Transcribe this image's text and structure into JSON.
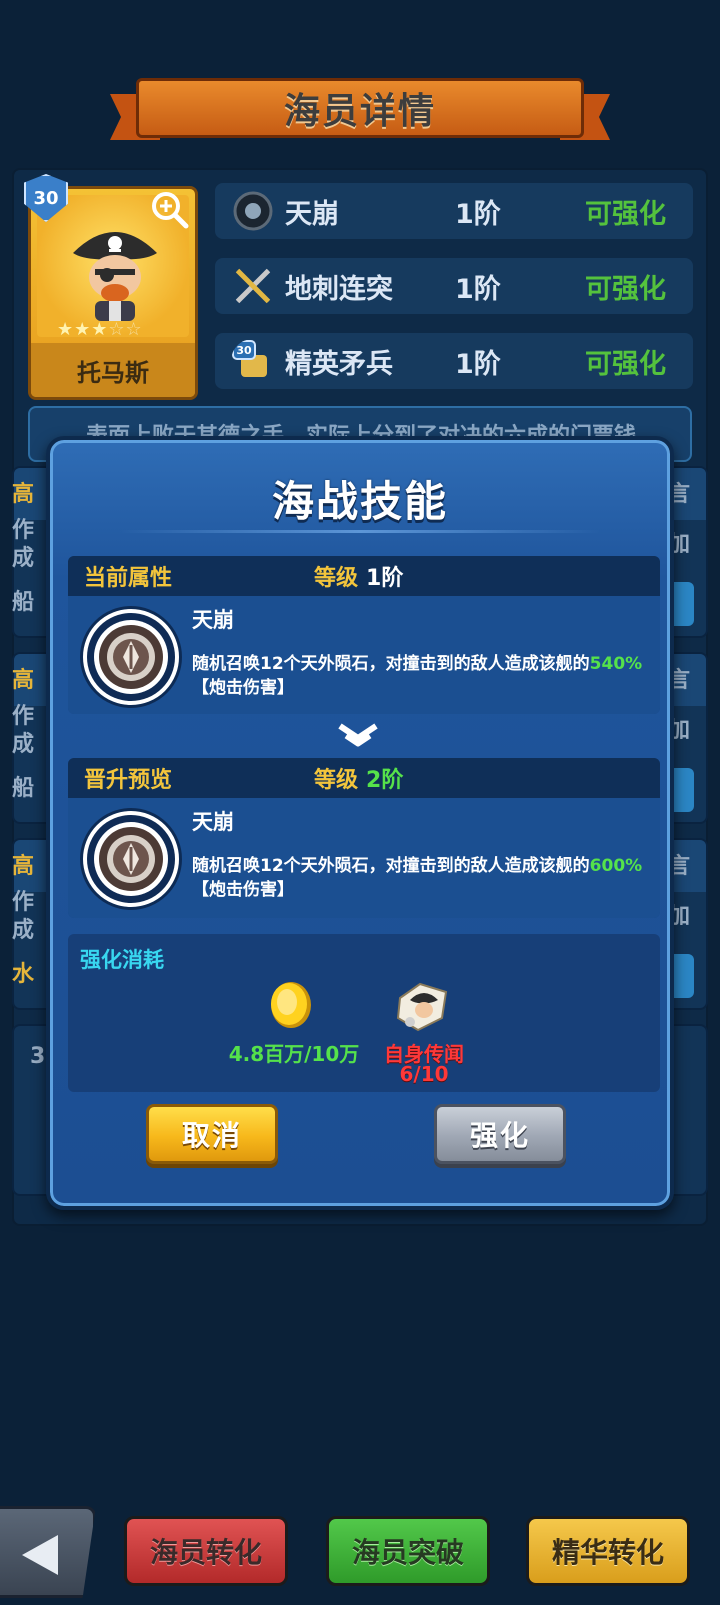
{
  "header": {
    "title": "海员详情"
  },
  "crew": {
    "level": "30",
    "name": "托马斯",
    "stars_filled": "★★★",
    "stars_empty": "☆☆",
    "description": "表面上败于其德之手，实际上分到了对决的六成的门票钱"
  },
  "skills": [
    {
      "name": "天崩",
      "tier": "1阶",
      "status": "可强化",
      "icon": "meteor-icon"
    },
    {
      "name": "地刺连突",
      "tier": "1阶",
      "status": "可强化",
      "icon": "crossed-swords-icon"
    },
    {
      "name": "精英矛兵",
      "tier": "1阶",
      "status": "可强化",
      "icon": "spearman-icon",
      "badge": "30"
    }
  ],
  "background_partial": {
    "left_col": [
      "高",
      "作",
      "成",
      "船",
      "高",
      "作",
      "成",
      "船",
      "高",
      "作",
      "成",
      "水",
      "3"
    ],
    "right_col": [
      "言",
      "加",
      "言",
      "加",
      "言",
      "加"
    ]
  },
  "modal": {
    "title": "海战技能",
    "current": {
      "label": "当前属性",
      "level_label": "等级",
      "level_value": "1阶",
      "skill_name": "天崩",
      "desc_prefix": "随机召唤12个天外陨石，对撞击到的敌人造成该舰的",
      "desc_pct": "540%",
      "desc_suffix": "【炮击伤害】"
    },
    "preview": {
      "label": "晋升预览",
      "level_label": "等级",
      "level_value": "2阶",
      "skill_name": "天崩",
      "desc_prefix": "随机召唤12个天外陨石，对撞击到的敌人造成该舰的",
      "desc_pct": "600%",
      "desc_suffix": "【炮击伤害】"
    },
    "cost": {
      "title": "强化消耗",
      "gold": "4.8百万/10万",
      "item_name": "自身传闻",
      "item_count": "6/10"
    },
    "buttons": {
      "cancel": "取消",
      "enhance": "强化"
    }
  },
  "nav": {
    "back": "back-arrow-icon",
    "convert": "海员转化",
    "breakthrough": "海员突破",
    "essence": "精华转化"
  },
  "colors": {
    "accent_gold": "#f3c53c",
    "green": "#55e24b",
    "red": "#ff3838",
    "cyan": "#38d7f0"
  }
}
